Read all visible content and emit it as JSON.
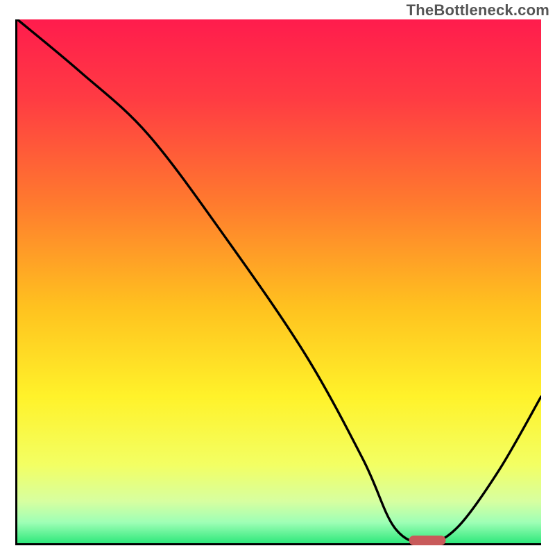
{
  "watermark": "TheBottleneck.com",
  "chart_data": {
    "type": "line",
    "title": "",
    "xlabel": "",
    "ylabel": "",
    "xlim": [
      0,
      100
    ],
    "ylim": [
      0,
      100
    ],
    "x": [
      0,
      12,
      25,
      40,
      55,
      66,
      72,
      78,
      84,
      92,
      100
    ],
    "values": [
      100,
      90,
      78,
      58,
      36,
      16,
      3,
      0,
      3,
      14,
      28
    ],
    "optimal_x": 78,
    "optimal_width_pct": 7,
    "gradient_stops": [
      {
        "offset": 0,
        "color": "#ff1c4d"
      },
      {
        "offset": 15,
        "color": "#ff3b43"
      },
      {
        "offset": 35,
        "color": "#ff7a2e"
      },
      {
        "offset": 55,
        "color": "#ffc21f"
      },
      {
        "offset": 72,
        "color": "#fff22a"
      },
      {
        "offset": 85,
        "color": "#f3ff63"
      },
      {
        "offset": 92,
        "color": "#d7ffa0"
      },
      {
        "offset": 96,
        "color": "#9fffb6"
      },
      {
        "offset": 100,
        "color": "#2fe87c"
      }
    ],
    "marker_color": "#c85a5a"
  }
}
